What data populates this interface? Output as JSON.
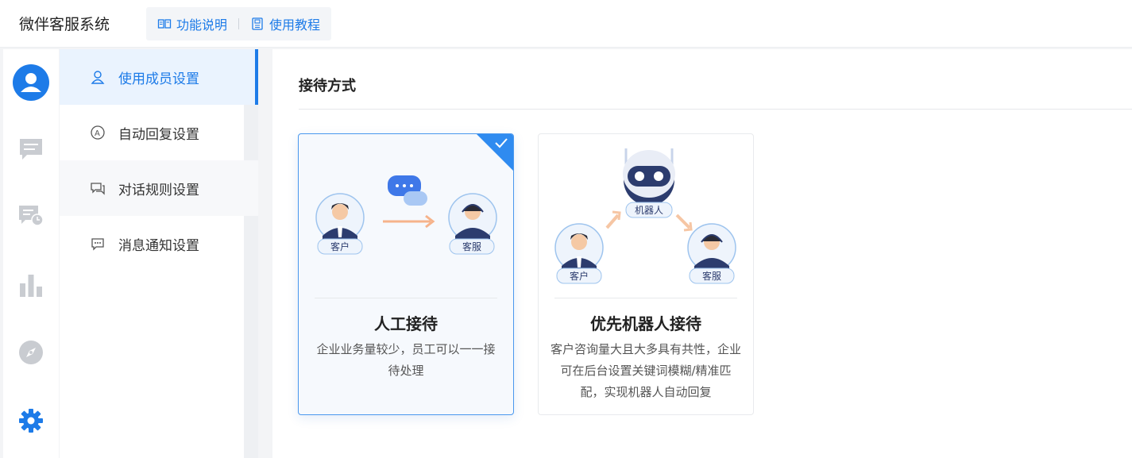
{
  "header": {
    "app_title": "微伴客服系统",
    "links": [
      {
        "label": "功能说明",
        "icon": "book-icon"
      },
      {
        "label": "使用教程",
        "icon": "document-icon"
      }
    ]
  },
  "rail": {
    "items": [
      {
        "name": "user-icon",
        "active": true
      },
      {
        "name": "chat-icon",
        "active": false
      },
      {
        "name": "chat-history-icon",
        "active": false
      },
      {
        "name": "bar-chart-icon",
        "active": false
      },
      {
        "name": "compass-icon",
        "active": false
      },
      {
        "name": "gear-icon",
        "active": true
      }
    ]
  },
  "submenu": {
    "items": [
      {
        "label": "使用成员设置",
        "icon": "user-outline-icon",
        "active": true
      },
      {
        "label": "自动回复设置",
        "icon": "auto-reply-icon",
        "active": false
      },
      {
        "label": "对话规则设置",
        "icon": "chat-rules-icon",
        "active": false
      },
      {
        "label": "消息通知设置",
        "icon": "message-icon",
        "active": false
      }
    ]
  },
  "main": {
    "section_title": "接待方式",
    "cards": [
      {
        "title": "人工接待",
        "desc": "企业业务量较少，员工可以一一接待处理",
        "selected": true,
        "labels": {
          "customer": "客户",
          "service": "客服"
        }
      },
      {
        "title": "优先机器人接待",
        "desc": "客户咨询量大且大多具有共性，企业可在后台设置关键词模糊/精准匹配，实现机器人自动回复",
        "selected": false,
        "labels": {
          "customer": "客户",
          "service": "客服",
          "robot": "机器人"
        }
      }
    ]
  },
  "colors": {
    "accent": "#1d7be8",
    "rail_inactive": "#c9ccd1",
    "selected_border": "#4a98ee"
  }
}
